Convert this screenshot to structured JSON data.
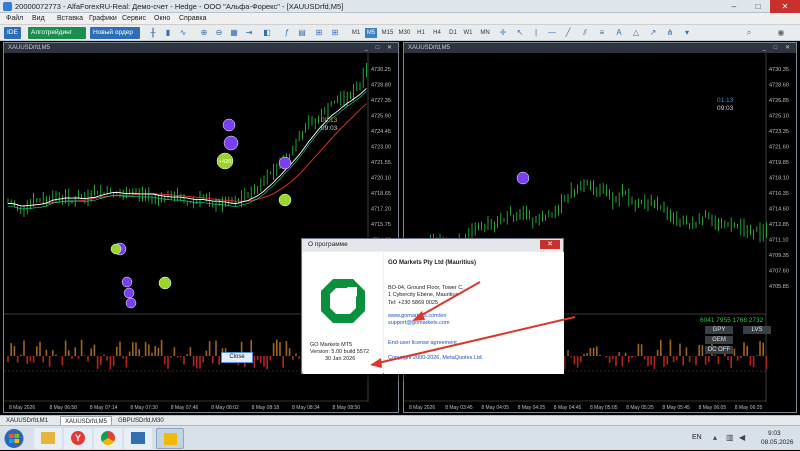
{
  "window": {
    "title": "20000072773 - AlfaForexRU-Real: Демо-счет - Hedge - ООО \"Альфа-Форекс\" - [XAUUSDrfd,M5]"
  },
  "menu": [
    "Файл",
    "Вид",
    "Вставка",
    "Графики",
    "Сервис",
    "Окно",
    "Справка"
  ],
  "toolbar": {
    "ide_label": "IDE",
    "algo_label": "Алготрейдинг",
    "new_order_label": "Новый ордер",
    "timeframes": [
      "M1",
      "M5",
      "M15",
      "M30",
      "H1",
      "H4",
      "D1",
      "W1",
      "MN"
    ],
    "selected_timeframe": "M5"
  },
  "chart_left": {
    "caption": "XAUUSDrfd,M5",
    "timer_1": "00:13",
    "timer_2": "09:03",
    "prices": [
      "4730.25",
      "4728.80",
      "4727.35",
      "4725.90",
      "4724.45",
      "4723.00",
      "4721.55",
      "4720.10",
      "4718.65",
      "4717.20",
      "4715.75",
      "4714.30",
      "4712.85",
      "4711.40",
      "4709.95"
    ],
    "times": [
      "8 May 2026",
      "8 May 06:58",
      "8 May 07:14",
      "8 May 07:30",
      "8 May 07:46",
      "8 May 08:02",
      "8 May 08:18",
      "8 May 08:34",
      "8 May 08:50"
    ],
    "bubbles": [
      "+420"
    ]
  },
  "chart_right": {
    "caption": "XAUUSDrfd,M5",
    "timer_1": "01:13",
    "timer_2": "09:03",
    "prices": [
      "4730.35",
      "4728.60",
      "4726.85",
      "4725.10",
      "4723.35",
      "4721.60",
      "4719.85",
      "4718.10",
      "4716.35",
      "4714.60",
      "4712.85",
      "4711.10",
      "4709.35",
      "4707.60",
      "4705.85"
    ],
    "times": [
      "8 May 2026",
      "8 May 03:45",
      "8 May 04:05",
      "8 May 04:25",
      "8 May 04:45",
      "8 May 05:05",
      "8 May 05:25",
      "8 May 05:45",
      "8 May 06:05",
      "8 May 06:25"
    ],
    "indicator_value": "6041 7955 1768 2732",
    "buttons": [
      "GPY",
      "LVS",
      "GEM",
      "DC OFF"
    ]
  },
  "dialog": {
    "title": "О программе",
    "company": "GO Markets Pty Ltd (Mauritius)",
    "address_1": "BO-04, Ground Floor, Tower C,",
    "address_2": "1 Cybercity Ebene, Mauritius",
    "phone": "Tel: +230 5869 0025",
    "website": "www.gomarkets.com/en",
    "email": "support@gomarkets.com",
    "license_link": "End-user license agreement",
    "copyright": "Copyright 2000-2026, MetaQuotes Ltd.",
    "product": "GO Markets MT5",
    "version": "Version: 5.00 build 5572",
    "date": "30 Jan 2026",
    "close_label": "Close",
    "logo_color": "#0a8f3c"
  },
  "statusbar": {
    "tabs": [
      "XAUUSDrfd,M1",
      "XAUUSDrfd,M5",
      "GBPUSDrfd,M30"
    ],
    "active_tab": 1
  },
  "taskbar": {
    "lang": "EN",
    "time": "9:03",
    "date": "08.05.2026"
  }
}
